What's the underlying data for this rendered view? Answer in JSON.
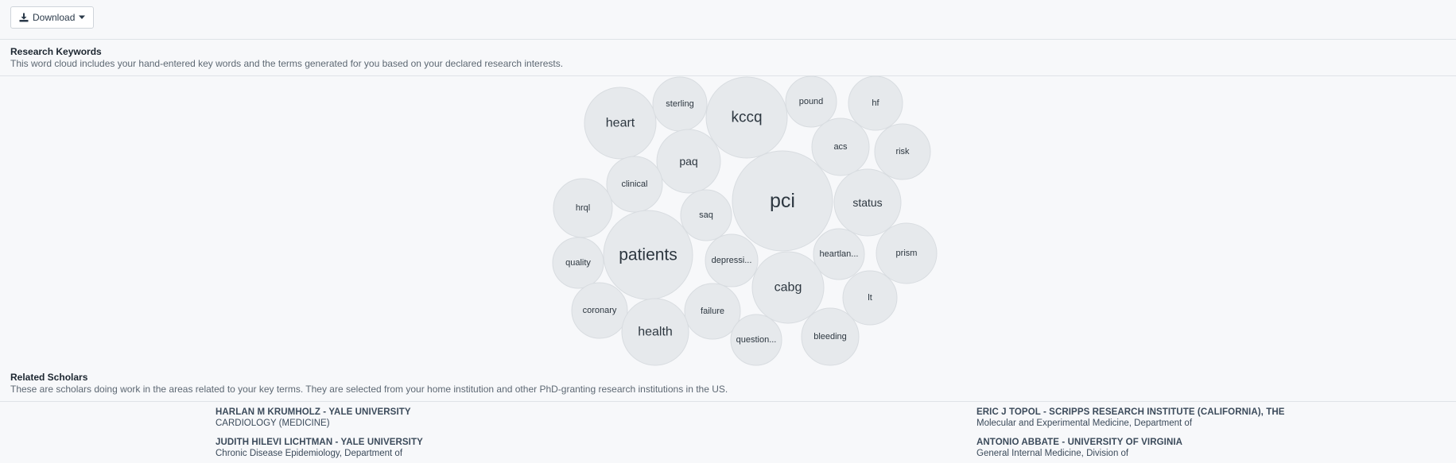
{
  "toolbar": {
    "download_label": "Download"
  },
  "keywords": {
    "title": "Research Keywords",
    "description": "This word cloud includes your hand-entered key words and the terms generated for you based on your declared research interests."
  },
  "cloud_terms": [
    {
      "label": "heart",
      "weight": 3
    },
    {
      "label": "sterling",
      "weight": 1
    },
    {
      "label": "kccq",
      "weight": 4
    },
    {
      "label": "pound",
      "weight": 1
    },
    {
      "label": "hf",
      "weight": 1
    },
    {
      "label": "acs",
      "weight": 1
    },
    {
      "label": "risk",
      "weight": 1
    },
    {
      "label": "paq",
      "weight": 2
    },
    {
      "label": "clinical",
      "weight": 1
    },
    {
      "label": "hrql",
      "weight": 1
    },
    {
      "label": "saq",
      "weight": 1
    },
    {
      "label": "pci",
      "weight": 6
    },
    {
      "label": "status",
      "weight": 2
    },
    {
      "label": "quality",
      "weight": 1
    },
    {
      "label": "patients",
      "weight": 5
    },
    {
      "label": "depressi...",
      "weight": 1
    },
    {
      "label": "heartlan...",
      "weight": 1
    },
    {
      "label": "prism",
      "weight": 1
    },
    {
      "label": "cabg",
      "weight": 3
    },
    {
      "label": "lt",
      "weight": 1
    },
    {
      "label": "coronary",
      "weight": 1
    },
    {
      "label": "failure",
      "weight": 1
    },
    {
      "label": "health",
      "weight": 3
    },
    {
      "label": "question...",
      "weight": 1
    },
    {
      "label": "bleeding",
      "weight": 1
    }
  ],
  "scholars": {
    "title": "Related Scholars",
    "description": "These are scholars doing work in the areas related to your key terms. They are selected from your home institution and other PhD-granting research institutions in the US.",
    "items": [
      {
        "name": "HARLAN M KRUMHOLZ - YALE UNIVERSITY",
        "dept": "CARDIOLOGY (MEDICINE)"
      },
      {
        "name": "ERIC J TOPOL - SCRIPPS RESEARCH INSTITUTE (CALIFORNIA), THE",
        "dept": "Molecular and Experimental Medicine, Department of"
      },
      {
        "name": "JUDITH HILEVI LICHTMAN - YALE UNIVERSITY",
        "dept": "Chronic Disease Epidemiology, Department of"
      },
      {
        "name": "ANTONIO ABBATE - UNIVERSITY OF VIRGINIA",
        "dept": "General Internal Medicine, Division of"
      }
    ]
  },
  "colors": {
    "bubble_fill": "#e6e9ec",
    "bubble_stroke": "#d8dce0",
    "bubble_text": "#2d3740"
  }
}
